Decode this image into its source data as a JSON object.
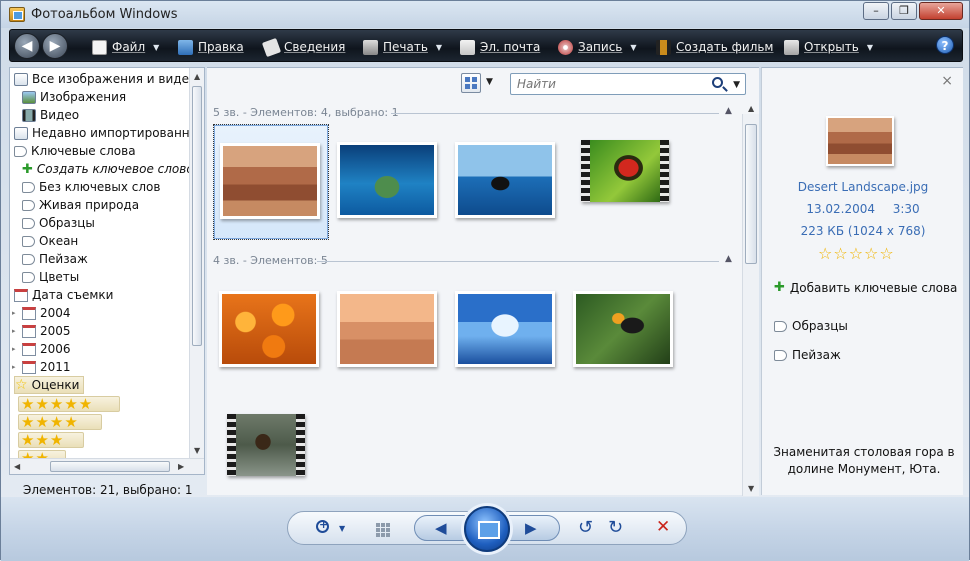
{
  "window": {
    "title": "Фотоальбом Windows",
    "minimize": "–",
    "maximize": "❐",
    "close": "✕"
  },
  "toolbar": {
    "back": "◀",
    "forward": "▶",
    "file": "Файл",
    "edit": "Правка",
    "info": "Сведения",
    "print": "Печать",
    "email": "Эл. почта",
    "burn": "Запись",
    "make_movie": "Создать фильм",
    "open": "Открыть",
    "help": "?"
  },
  "sidebar": {
    "items": [
      {
        "label": "Все изображения и видео"
      },
      {
        "label": "Изображения"
      },
      {
        "label": "Видео"
      },
      {
        "label": "Недавно импортированные"
      },
      {
        "label": "Ключевые слова"
      },
      {
        "label": "Создать ключевое слово"
      },
      {
        "label": "Без ключевых слов"
      },
      {
        "label": "Живая природа"
      },
      {
        "label": "Образцы"
      },
      {
        "label": "Океан"
      },
      {
        "label": "Пейзаж"
      },
      {
        "label": "Цветы"
      },
      {
        "label": "Дата съемки"
      },
      {
        "label": "2004"
      },
      {
        "label": "2005"
      },
      {
        "label": "2006"
      },
      {
        "label": "2011"
      },
      {
        "label": "Оценки"
      }
    ],
    "ratings": [
      "★★★★★",
      "★★★★",
      "★★★",
      "★★"
    ]
  },
  "search": {
    "placeholder": "Найти"
  },
  "groups": [
    {
      "header": "5 зв. - Элементов: 4, выбрано: 1"
    },
    {
      "header": "4 зв. - Элементов: 5"
    }
  ],
  "status": {
    "text": "Элементов: 21, выбрано: 1"
  },
  "info": {
    "close": "×",
    "filename": "Desert Landscape.jpg",
    "date": "13.02.2004",
    "time": "3:30",
    "size": "223 КБ (1024 x 768)",
    "rating_stars": "☆☆☆☆☆",
    "add_tags": "Добавить ключевые слова",
    "tags": [
      "Образцы",
      "Пейзаж"
    ],
    "description": "Знаменитая столовая гора в долине Монумент, Юта."
  },
  "controls": {
    "prev": "◀",
    "next": "▶",
    "rotate_left": "↺",
    "rotate_right": "↻",
    "delete": "✕"
  },
  "colors": {
    "accent": "#3a6db5",
    "toolbar": "#1a222c",
    "delete": "#c9241b"
  }
}
